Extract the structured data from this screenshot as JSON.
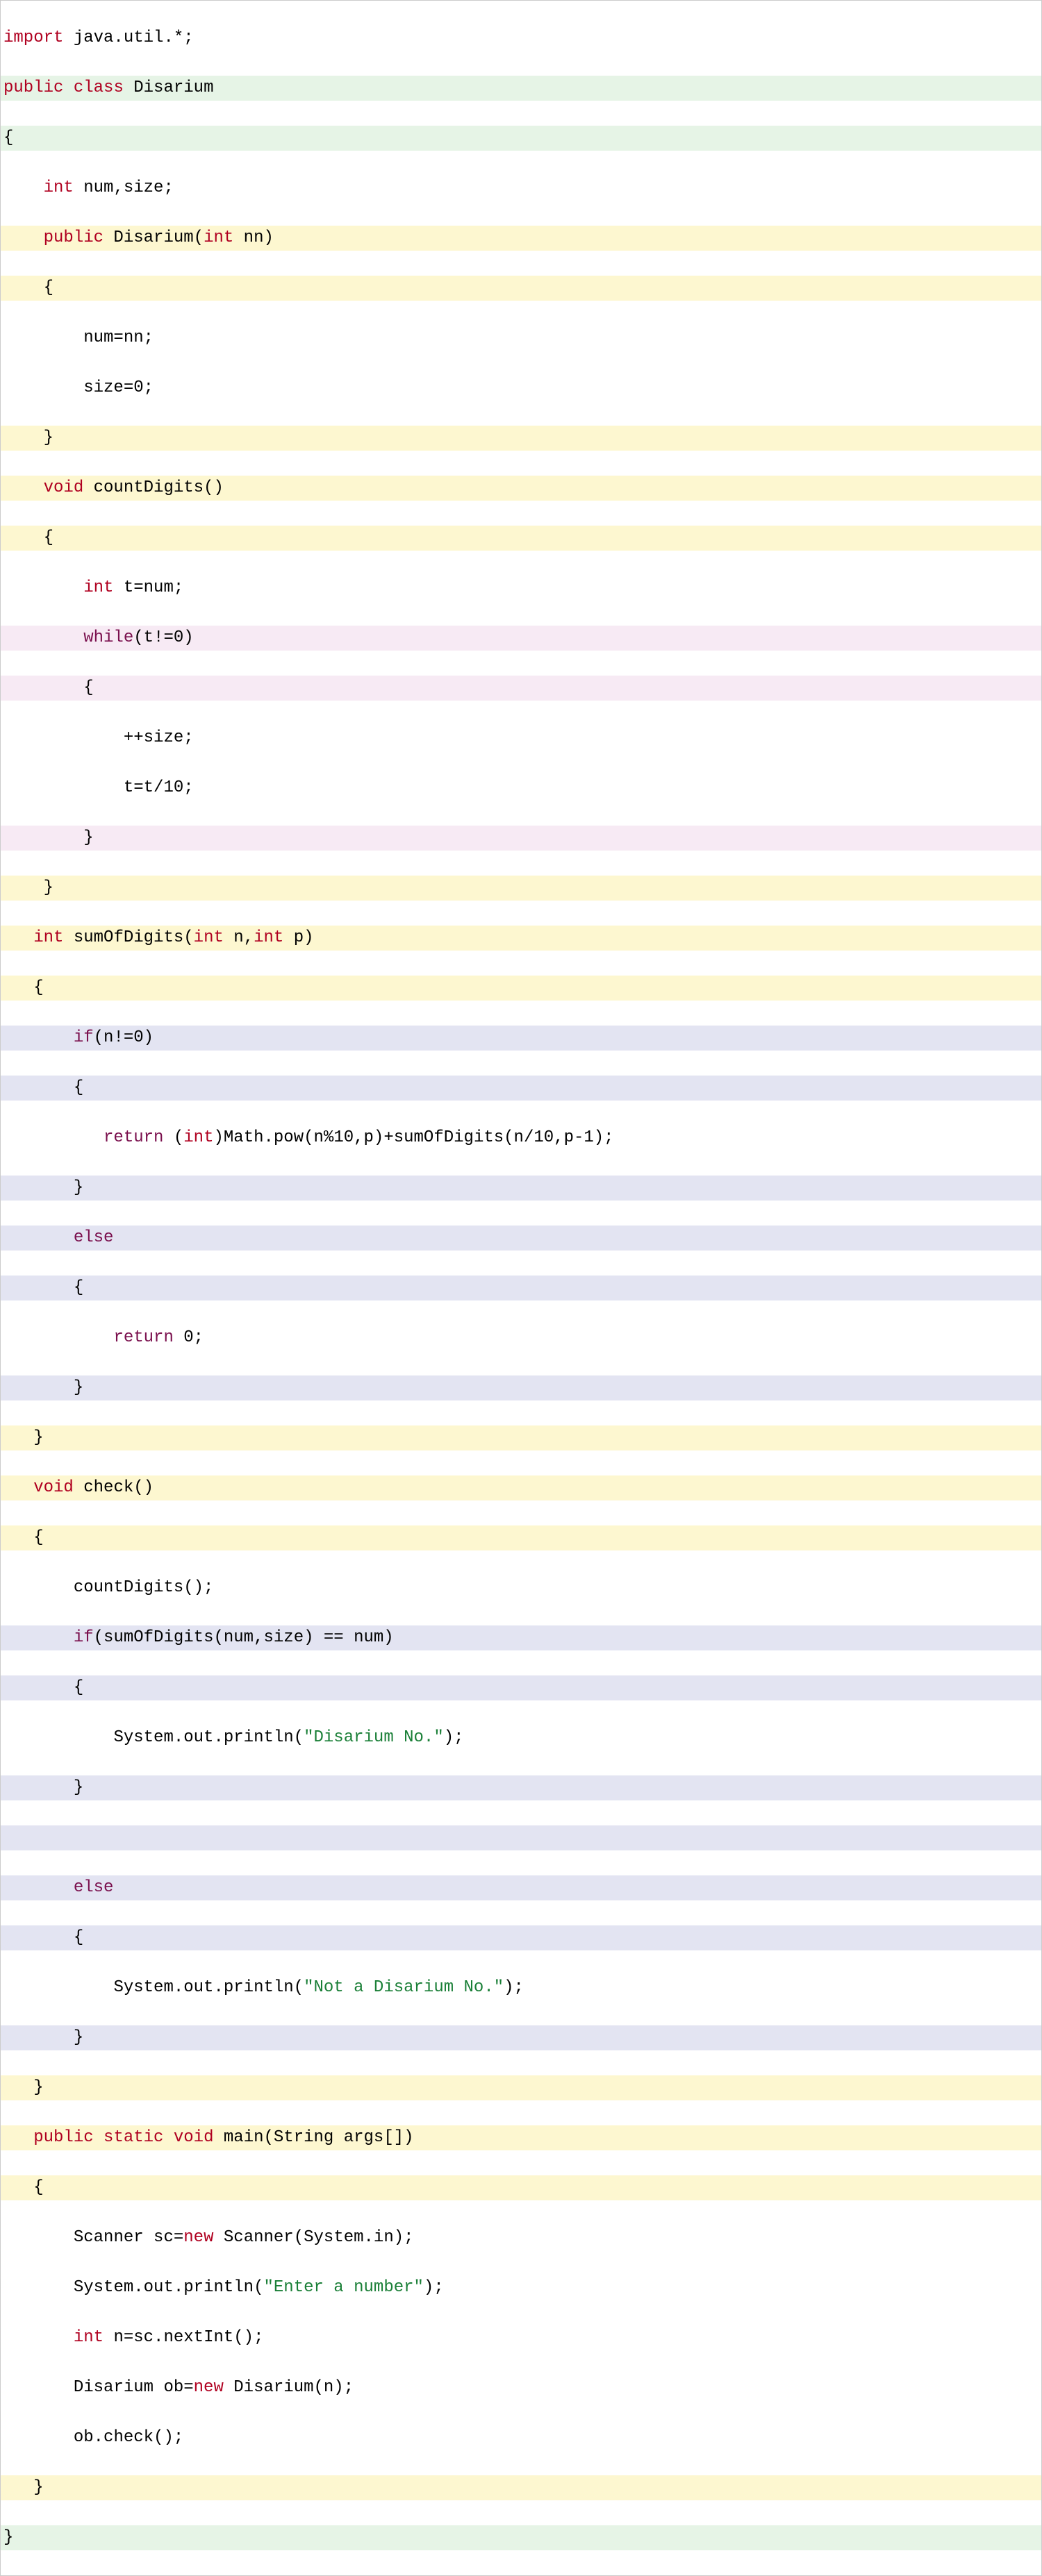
{
  "tokens": {
    "import": "import",
    "public": "public",
    "class": "class",
    "static": "static",
    "void": "void",
    "int": "int",
    "new": "new",
    "while": "while",
    "if": "if",
    "else": "else",
    "return": "return"
  },
  "ids": {
    "javaUtil": " java.util.*;",
    "Disarium": " Disarium",
    "numSize": " num,size;",
    "DisariumCtor": " Disarium(",
    "nnParam": " nn)",
    "numAssign": "num=nn;",
    "sizeAssign": "size=0;",
    "countDigitsDecl": " countDigits()",
    "tDecl": " t=num;",
    "whileCond": "(t!=0)",
    "incSize": "++size;",
    "tDiv": "t=t/10;",
    "sumOfDigitsDecl": " sumOfDigits(",
    "nParam": " n,",
    "pParam": " p)",
    "ifN": "(n!=0)",
    "returnPow": " (",
    "mathPow": ")Math.pow(n%10,p)+sumOfDigits(n/10,p-1);",
    "returnZero": " 0;",
    "checkDecl": " check()",
    "countDigitsCall": "countDigits();",
    "ifSum": "(sumOfDigits(num,size) == num)",
    "sysOut1a": "System.out.println(",
    "sysOut1b": ");",
    "sysOut2a": "System.out.println(",
    "sysOut2b": ");",
    "mainDecl": " main(String args[])",
    "scanner1": "Scanner sc=",
    "scanner2": " Scanner(System.in);",
    "enterNumA": "System.out.println(",
    "enterNumB": ");",
    "nInput": " n=sc.nextInt();",
    "obDecl1": "Disarium ob=",
    "obDecl2": " Disarium(n);",
    "obCheck": "ob.check();"
  },
  "strings": {
    "disariumYes": "\"Disarium No.\"",
    "disariumNo": "\"Not a Disarium No.\"",
    "enterNumber": "\"Enter a number\""
  },
  "braces": {
    "open": "{",
    "close": "}"
  }
}
